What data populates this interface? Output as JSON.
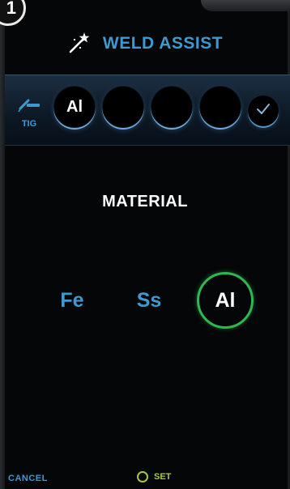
{
  "step_badge": "1",
  "header": {
    "title": "WELD ASSIST",
    "icon": "magic-wand-icon"
  },
  "process": {
    "label": "TIG",
    "icon": "tig-torch-icon"
  },
  "steps": [
    {
      "value": "Al"
    },
    {
      "value": ""
    },
    {
      "value": ""
    },
    {
      "value": ""
    }
  ],
  "confirm_icon": "checkmark-icon",
  "section_title": "MATERIAL",
  "materials": [
    {
      "label": "Fe",
      "selected": false
    },
    {
      "label": "Ss",
      "selected": false
    },
    {
      "label": "Al",
      "selected": true
    }
  ],
  "footer": {
    "cancel_label": "CANCEL",
    "set_label": "SET"
  },
  "colors": {
    "accent_blue": "#3d9ad0",
    "selected_green": "#2fb84f",
    "set_green": "#a6c93a",
    "background": "#050607"
  }
}
